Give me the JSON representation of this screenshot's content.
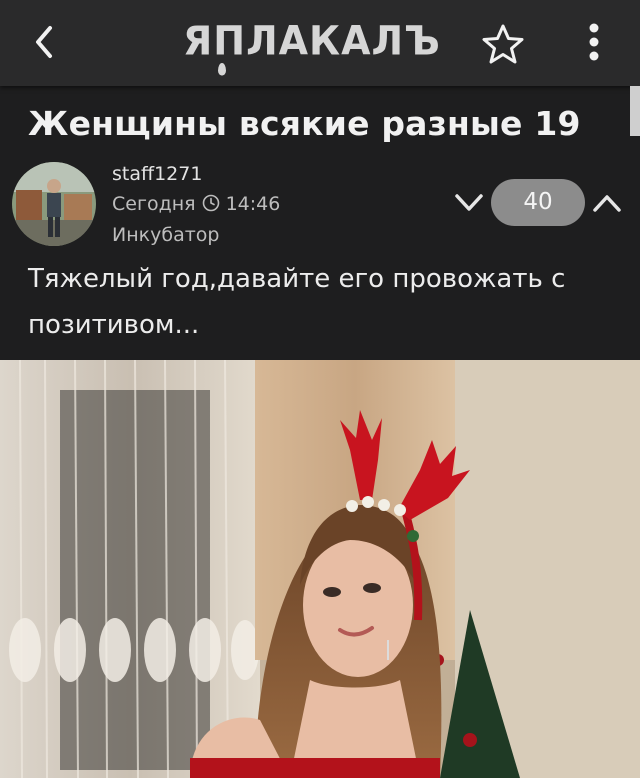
{
  "header": {
    "logo_text": "ЯПЛАКАЛЪ",
    "back_icon": "chevron-left-icon",
    "favorite_icon": "star-outline-icon",
    "menu_icon": "more-vertical-icon"
  },
  "post": {
    "title": "Женщины всякие разные 19",
    "author": "staff1271",
    "date": "Сегодня",
    "time": "14:46",
    "section": "Инкубатор",
    "rating": "40",
    "text": "Тяжелый год,давайте его провожать с позитивом..."
  },
  "colors": {
    "background": "#1e1e1f",
    "topbar": "#2a2a2b",
    "rating_pill": "#8c8c8c",
    "text": "#ececec"
  }
}
